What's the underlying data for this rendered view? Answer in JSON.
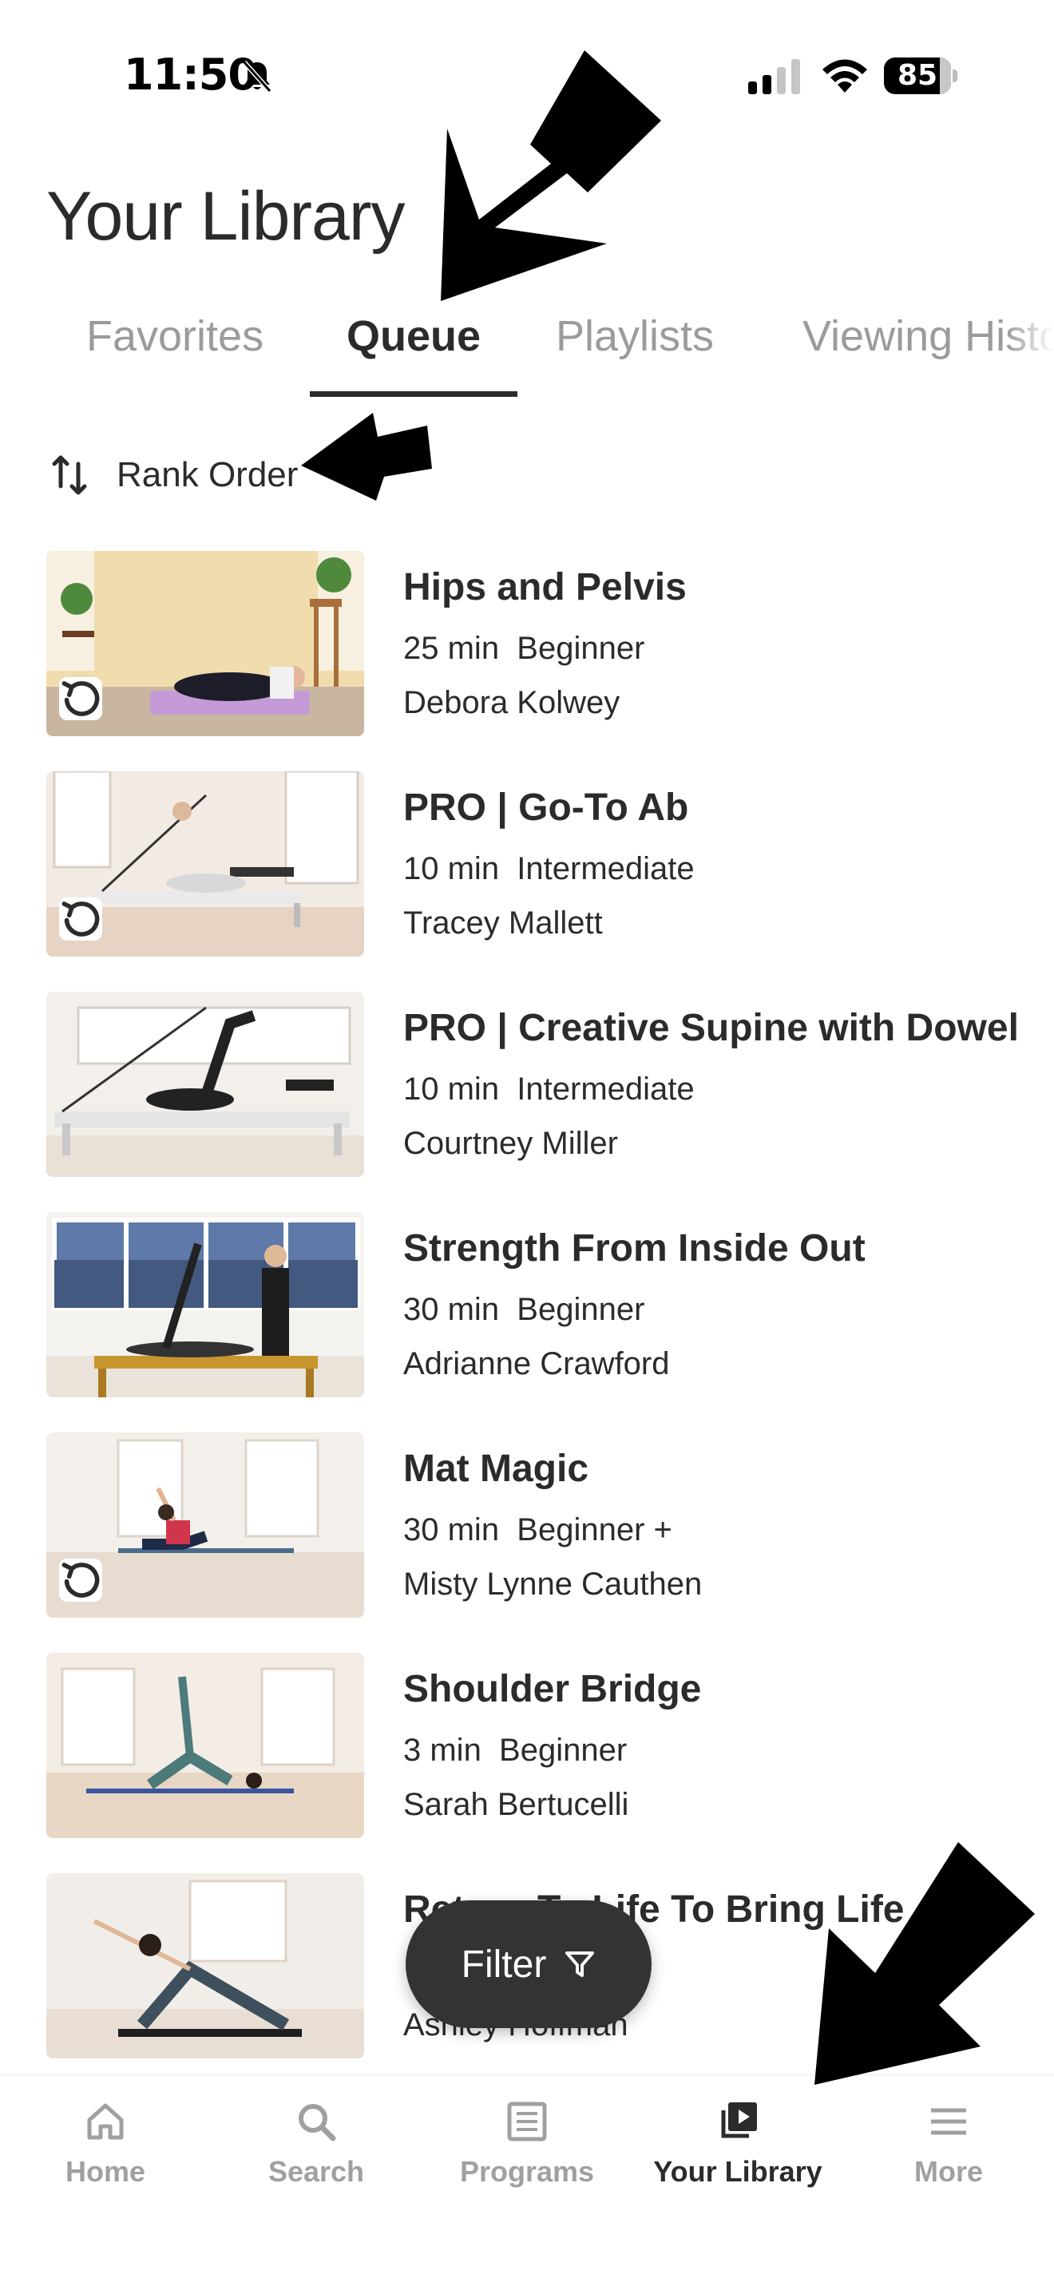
{
  "status_bar": {
    "time": "11:50",
    "battery": "85",
    "battery_level": 0.85,
    "icons": [
      "bell-slash-icon",
      "cellular-signal-icon",
      "wifi-icon",
      "battery-icon"
    ]
  },
  "page": {
    "title": "Your Library"
  },
  "tabs": [
    {
      "label": "Favorites",
      "active": false
    },
    {
      "label": "Queue",
      "active": true
    },
    {
      "label": "Playlists",
      "active": false
    },
    {
      "label": "Viewing History",
      "active": false
    }
  ],
  "sort": {
    "label": "Rank Order",
    "icon": "sort-arrows-icon"
  },
  "items": [
    {
      "title": "Hips and Pelvis",
      "meta": "25 min  Beginner",
      "instructor": "Debora Kolwey",
      "watched": true
    },
    {
      "title": "PRO | Go-To Ab",
      "meta": "10 min  Intermediate",
      "instructor": "Tracey Mallett",
      "watched": true
    },
    {
      "title": "PRO | Creative Supine with Dowel",
      "meta": "10 min  Intermediate",
      "instructor": "Courtney Miller",
      "watched": false
    },
    {
      "title": "Strength From Inside Out",
      "meta": "30 min  Beginner",
      "instructor": "Adrianne Crawford",
      "watched": false
    },
    {
      "title": "Mat Magic",
      "meta": "30 min  Beginner +",
      "instructor": "Misty Lynne Cauthen",
      "watched": true
    },
    {
      "title": "Shoulder Bridge",
      "meta": "3 min  Beginner",
      "instructor": "Sarah Bertucelli",
      "watched": false
    },
    {
      "title": "Return To Life To Bring Life",
      "meta": "",
      "instructor": "Ashley Hoffman",
      "watched": false
    }
  ],
  "filter": {
    "label": "Filter",
    "icon": "filter-funnel-icon"
  },
  "bottom_nav": [
    {
      "label": "Home",
      "icon": "home-icon",
      "active": false
    },
    {
      "label": "Search",
      "icon": "search-icon",
      "active": false
    },
    {
      "label": "Programs",
      "icon": "programs-icon",
      "active": false
    },
    {
      "label": "Your Library",
      "icon": "library-icon",
      "active": true
    },
    {
      "label": "More",
      "icon": "menu-icon",
      "active": false
    }
  ],
  "colors": {
    "text_primary": "#2b2b2b",
    "text_inactive": "#9b9b9b",
    "filter_bg": "#333333",
    "annotation_arrow": "#000000"
  }
}
